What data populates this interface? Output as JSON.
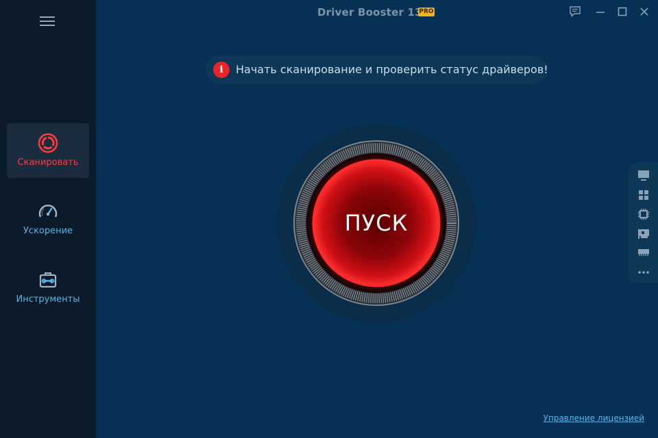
{
  "app": {
    "title": "Driver Booster 13",
    "badge": "PRO"
  },
  "titlebar": {
    "buttons": [
      "feedback-icon",
      "minimize-icon",
      "maximize-icon",
      "close-icon"
    ]
  },
  "sidebar": {
    "menu_icon": "hamburger-menu-icon",
    "items": [
      {
        "label": "Сканировать",
        "icon": "scan-icon",
        "active": true
      },
      {
        "label": "Ускорение",
        "icon": "speedometer-icon",
        "active": false
      },
      {
        "label": "Инструменты",
        "icon": "toolbox-icon",
        "active": false
      }
    ]
  },
  "banner": {
    "icon": "info-icon",
    "icon_glyph": "i",
    "text": "Начать сканирование и проверить статус драйверов!"
  },
  "scan": {
    "button_label": "ПУСК"
  },
  "device_panel": {
    "icons": [
      "monitor-icon",
      "windows-icon",
      "cpu-icon",
      "network-card-icon",
      "memory-icon",
      "more-icon"
    ]
  },
  "footer": {
    "license_link": "Управление лицензией"
  },
  "colors": {
    "background": "#063154",
    "sidebar": "#0b1b2a",
    "accent_red": "#ff3b3b",
    "link_blue": "#5ab4ee",
    "badge_gold": "#f2b31c"
  }
}
